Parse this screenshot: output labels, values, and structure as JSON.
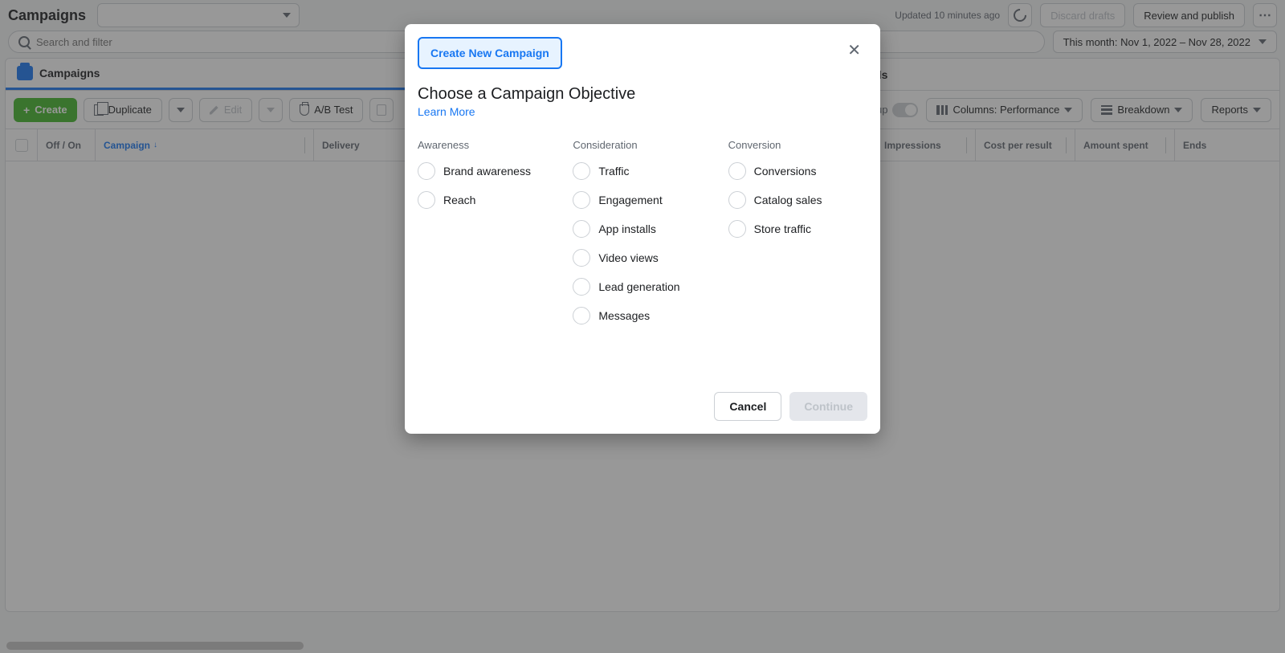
{
  "page_title": "Campaigns",
  "updated": "Updated 10 minutes ago",
  "discard": "Discard drafts",
  "review": "Review and publish",
  "search_placeholder": "Search and filter",
  "date_range": "This month: Nov 1, 2022 – Nov 28, 2022",
  "tabs": {
    "campaigns": "Campaigns",
    "ads": "Ads"
  },
  "toolbar": {
    "create": "Create",
    "duplicate": "Duplicate",
    "edit": "Edit",
    "abtest": "A/B Test",
    "setup": "Setup",
    "columns": "Columns: Performance",
    "breakdown": "Breakdown",
    "reports": "Reports"
  },
  "columns": {
    "offon": "Off / On",
    "campaign": "Campaign",
    "delivery": "Delivery",
    "impressions": "Impressions",
    "cpr": "Cost per result",
    "spent": "Amount spent",
    "ends": "Ends"
  },
  "modal": {
    "tab": "Create New Campaign",
    "title": "Choose a Campaign Objective",
    "learn": "Learn More",
    "headers": {
      "a": "Awareness",
      "b": "Consideration",
      "c": "Conversion"
    },
    "awareness": [
      "Brand awareness",
      "Reach"
    ],
    "consideration": [
      "Traffic",
      "Engagement",
      "App installs",
      "Video views",
      "Lead generation",
      "Messages"
    ],
    "conversion": [
      "Conversions",
      "Catalog sales",
      "Store traffic"
    ],
    "cancel": "Cancel",
    "continue": "Continue"
  }
}
